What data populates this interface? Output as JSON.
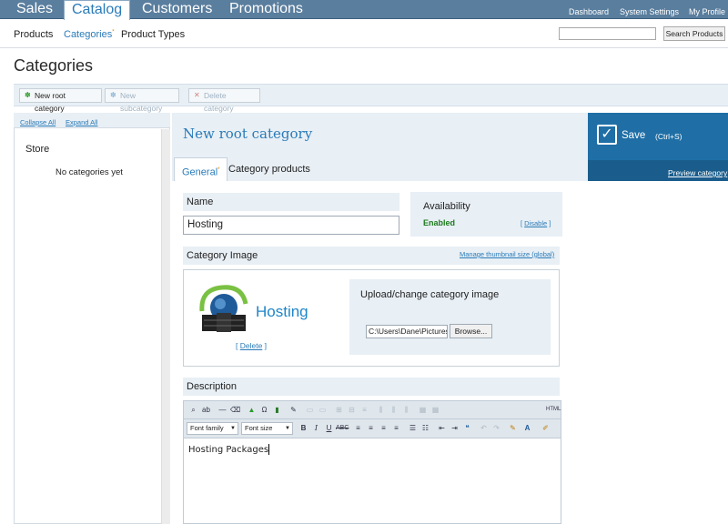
{
  "topnav": {
    "tabs": [
      {
        "label": "Sales",
        "active": false
      },
      {
        "label": "Catalog",
        "active": true
      },
      {
        "label": "Customers",
        "active": false
      },
      {
        "label": "Promotions",
        "active": false
      }
    ],
    "links": [
      "Dashboard",
      "System Settings",
      "My Profile"
    ]
  },
  "subnav": {
    "items": [
      "Products",
      "Categories",
      "Product Types"
    ],
    "active_marker": "*",
    "search_placeholder": "",
    "search_button": "Search Products"
  },
  "page": {
    "title": "Categories"
  },
  "actions": {
    "new_root": "New root category",
    "new_sub": "New subcategory",
    "delete": "Delete category"
  },
  "sidebar": {
    "collapse_all": "Collapse All",
    "expand_all": "Expand All",
    "root": "Store",
    "empty_text": "No categories yet"
  },
  "form": {
    "title": "New root category",
    "tabs": [
      "General",
      "Category products"
    ],
    "active_marker": "*",
    "save_label": "Save",
    "save_shortcut": "(Ctrl+S)",
    "preview_link": "Preview category",
    "name_label": "Name",
    "name_value": "Hosting",
    "availability_title": "Availability",
    "availability_status": "Enabled",
    "availability_disable": "Disable",
    "image_section": "Category Image",
    "manage_thumbnail_link": "Manage thumbnail size (global)",
    "image_caption": "Hosting",
    "image_delete": "Delete",
    "upload_title": "Upload/change category image",
    "file_value": "C:\\Users\\Dane\\Pictures",
    "browse_label": "Browse...",
    "description_section": "Description",
    "font_family_select": "Font family",
    "font_size_select": "Font size",
    "description_text": "Hosting Packages"
  },
  "colors": {
    "nav_bar": "#5a7e9e",
    "link_blue": "#2a7bb8",
    "save_panel": "#1f6fa6",
    "panel_bg": "#e8eff5",
    "enabled_green": "#1d7a1d"
  }
}
